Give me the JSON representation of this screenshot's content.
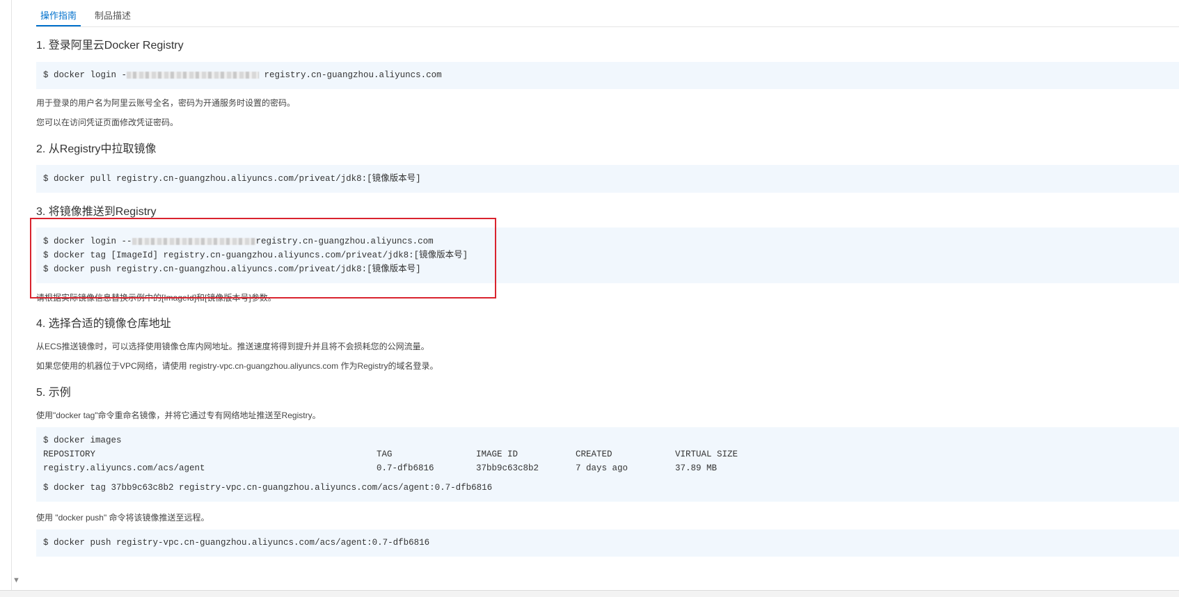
{
  "tabs": {
    "active": "操作指南",
    "inactive": "制品描述"
  },
  "sections": {
    "s1": {
      "title": "1. 登录阿里云Docker Registry",
      "cmd_prefix": "$ docker login -",
      "cmd_suffix": " registry.cn-guangzhou.aliyuncs.com",
      "desc1": "用于登录的用户名为阿里云账号全名，密码为开通服务时设置的密码。",
      "desc2": "您可以在访问凭证页面修改凭证密码。"
    },
    "s2": {
      "title": "2. 从Registry中拉取镜像",
      "cmd": "$ docker pull registry.cn-guangzhou.aliyuncs.com/priveat/jdk8:[镜像版本号]"
    },
    "s3": {
      "title": "3. 将镜像推送到Registry",
      "cmd1_prefix": "$ docker login --",
      "cmd1_suffix": "registry.cn-guangzhou.aliyuncs.com",
      "cmd2": "$ docker tag [ImageId] registry.cn-guangzhou.aliyuncs.com/priveat/jdk8:[镜像版本号]",
      "cmd3": "$ docker push registry.cn-guangzhou.aliyuncs.com/priveat/jdk8:[镜像版本号]",
      "desc": "请根据实际镜像信息替换示例中的[ImageId]和[镜像版本号]参数。"
    },
    "s4": {
      "title": "4. 选择合适的镜像仓库地址",
      "desc1": "从ECS推送镜像时，可以选择使用镜像仓库内网地址。推送速度将得到提升并且将不会损耗您的公网流量。",
      "desc2": "如果您使用的机器位于VPC网络，请使用 registry-vpc.cn-guangzhou.aliyuncs.com 作为Registry的域名登录。"
    },
    "s5": {
      "title": "5. 示例",
      "desc1": "使用\"docker tag\"命令重命名镜像，并将它通过专有网络地址推送至Registry。",
      "cmd_images": "$ docker images",
      "table_headers": [
        "REPOSITORY",
        "TAG",
        "IMAGE ID",
        "CREATED",
        "VIRTUAL SIZE"
      ],
      "table_row": [
        "registry.aliyuncs.com/acs/agent",
        "0.7-dfb6816",
        "37bb9c63c8b2",
        "7 days ago",
        "37.89 MB"
      ],
      "cmd_tag": "$ docker tag 37bb9c63c8b2 registry-vpc.cn-guangzhou.aliyuncs.com/acs/agent:0.7-dfb6816",
      "desc2": "使用 \"docker push\" 命令将该镜像推送至远程。",
      "cmd_push": "$ docker push registry-vpc.cn-guangzhou.aliyuncs.com/acs/agent:0.7-dfb6816"
    }
  },
  "icons": {
    "scroll_down": "▼"
  },
  "colors": {
    "accent": "#0070cc",
    "code_bg": "#f1f7fd",
    "highlight": "#d9232e"
  }
}
